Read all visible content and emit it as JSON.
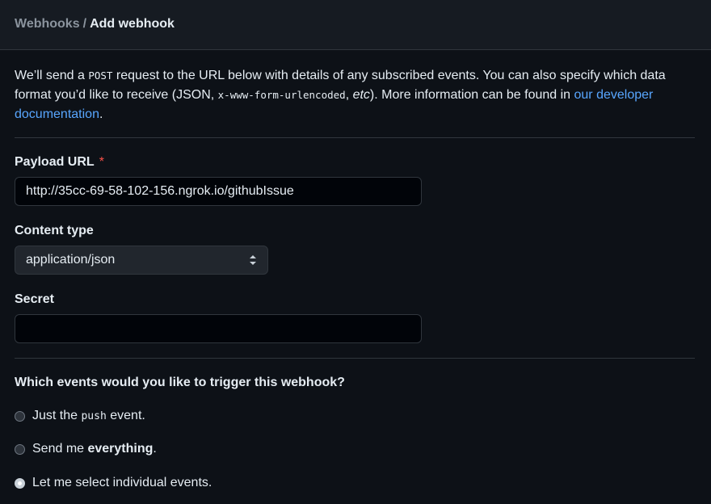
{
  "header": {
    "breadcrumb_parent": "Webhooks",
    "breadcrumb_separator": "/",
    "breadcrumb_current": "Add webhook"
  },
  "intro": {
    "part1": "We’ll send a ",
    "code_post": "POST",
    "part2": " request to the URL below with details of any subscribed events. You can also specify which data format you’d like to receive (JSON, ",
    "code_format": "x-www-form-urlencoded",
    "part3": ", ",
    "etc": "etc",
    "part4": "). More information can be found in ",
    "link_text": "our developer documentation",
    "part5": "."
  },
  "form": {
    "payload_url_label": "Payload URL",
    "required_mark": "*",
    "payload_url_value": "http://35cc-69-58-102-156.ngrok.io/githubIssue",
    "content_type_label": "Content type",
    "content_type_value": "application/json",
    "secret_label": "Secret",
    "secret_value": ""
  },
  "events": {
    "question": "Which events would you like to trigger this webhook?",
    "options": [
      {
        "prefix": "Just the ",
        "code": "push",
        "suffix": " event.",
        "checked": false
      },
      {
        "prefix": "Send me ",
        "bold": "everything",
        "suffix": ".",
        "checked": false
      },
      {
        "text": "Let me select individual events.",
        "checked": true
      }
    ]
  },
  "icons": {
    "select_chevron": "chevron-up-down-icon"
  },
  "colors": {
    "background": "#0d1117",
    "header_background": "#161b22",
    "border": "#30363d",
    "link": "#58a6ff",
    "required": "#f85149",
    "muted": "#8b949e"
  }
}
